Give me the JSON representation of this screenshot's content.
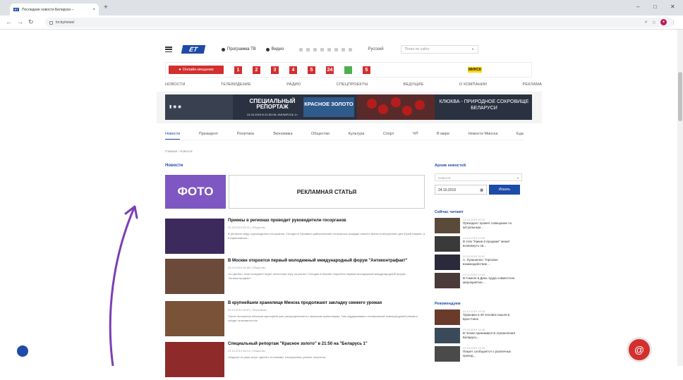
{
  "browser": {
    "tab_title": "Последние новости Беларуси –",
    "tab_close": "×",
    "new_tab": "+",
    "url": "tvr.by/news/",
    "controls": {
      "min": "–",
      "max": "□",
      "close": "✕"
    }
  },
  "header": {
    "logo": "ET",
    "program_label": "Программа ТВ",
    "video_label": "Видео",
    "lang": "Русский",
    "search_placeholder": "Поиск по сайту"
  },
  "channels_bar": {
    "online_label": "Онлайн-вещание",
    "channels": [
      "1",
      "2",
      "3",
      "4",
      "5",
      "24",
      "",
      "5"
    ],
    "brands": [
      "",
      "",
      "",
      "",
      "МИНСК"
    ]
  },
  "main_nav": [
    "НОВОСТИ",
    "ТЕЛЕВИДЕНИЕ",
    "РАДИО",
    "СПЕЦПРОЕКТЫ",
    "ВЕДУЩИЕ",
    "О КОМПАНИИ",
    "РЕКЛАМА"
  ],
  "banner": {
    "left": "СПЕЦИАЛЬНЫЙ РЕПОРТАЖ",
    "left_sub": "24.10.2019 В 21:50 НА «БЕЛАРУСЬ 1»",
    "center": "КРАСНОЕ ЗОЛОТО",
    "right": "КЛЮКВА - ПРИРОДНОЕ СОКРОВИЩЕ БЕЛАРУСИ"
  },
  "sub_nav": [
    "Новости",
    "Президент",
    "Политика",
    "Экономика",
    "Общество",
    "Культура",
    "Спорт",
    "ЧП",
    "В мире",
    "Новости Минска",
    "Еда"
  ],
  "breadcrumbs": "Главная › Новости",
  "section_title": "Новости",
  "promo": {
    "foto": "ФОТО",
    "ad": "РЕКЛАМНАЯ СТАТЬЯ"
  },
  "news": [
    {
      "title": "Приемы в регионах проводит руководители госорганов",
      "meta": "24.10.2019 09:11 | Общество",
      "snippet": "В регионах ведут руководители госорганов. Сегодня в Пуховичи райисполкоме на вопросы граждан ответит министр внутренних дел Юрий Караев, а в Барановичах..."
    },
    {
      "title": "В Москве откроется первый молодежный международный форум \"Антиконтрафакт\"",
      "meta": "24.10.2019 08:58 | Общество",
      "snippet": "Что делать, если конкурент ведет нечестную игру на рынке? Сегодня в Москве откроется первый молодежный международный форум \"Антиконтрафакт\"."
    },
    {
      "title": "В крупнейшем хранилище Минска продолжают закладку свежего урожая",
      "meta": "24.10.2019 08:57 | Экономика",
      "snippet": "После погашения объемов картофеля уже распределения по овощным хранилищам. Там поддерживают оптимальный температурный режим и следят за влажностью."
    },
    {
      "title": "Специальный репортаж \"Красное золото\" в 21:50 на \"Беларусь 1\"",
      "meta": "24.10.2019 08:13 | Общество",
      "snippet": "Заядлые из рака могут сделать из клюквы. Белорусские ученые получили..."
    }
  ],
  "right": {
    "archive_title": "Архив новостей",
    "archive_select": "Новости",
    "date": "24.10.2019",
    "show_button": "Искать",
    "reading_title": "Сейчас читают",
    "reading": [
      {
        "date": "23.10.2019 15:10",
        "text": "Президент провел совещание по актуальным..."
      },
      {
        "date": "23.10.2019 11:38",
        "text": "В этих \"Какие в продаже\" может возникнуть на..."
      },
      {
        "date": "23.10.2019 15:01",
        "text": "А. Лукашенко: Торговое взаимодействие..."
      },
      {
        "date": "23.10.2019 12:24",
        "text": "В Гомеле в День труда совместное мероприятие..."
      }
    ],
    "recommend_title": "Рекомендуем",
    "recommend": [
      {
        "date": "23.10.2019 15:15",
        "text": "Тружники и 30 человек нашли в Брестчине"
      },
      {
        "date": "23.10.2019 14:48",
        "text": "В Чехии принимаются ограничения Беларусь..."
      },
      {
        "date": "23.10.2019 13:25",
        "text": "Пакует сообщается о различных приезд..."
      }
    ]
  },
  "floater_label": "",
  "chat_icon": "@"
}
